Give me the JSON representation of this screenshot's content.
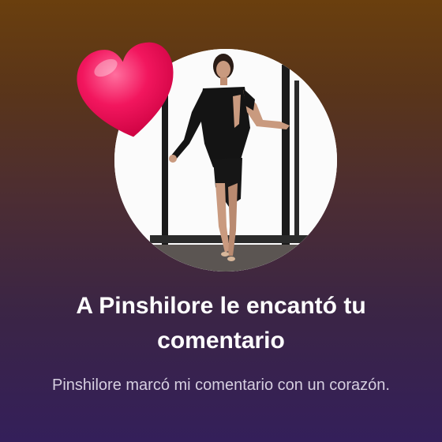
{
  "notification": {
    "title": "A Pinshilore le encantó tu comentario",
    "message": "Pinshilore marcó mi comentario con un corazón."
  },
  "avatar": {
    "icon": "profile-photo"
  },
  "reaction": {
    "icon": "heart-icon",
    "color": "#f2165e"
  },
  "theme": {
    "background_top": "#6a3f0e",
    "background_bottom": "#341f5a",
    "title_color": "#ffffff",
    "subtitle_color": "#d6cfe0"
  }
}
